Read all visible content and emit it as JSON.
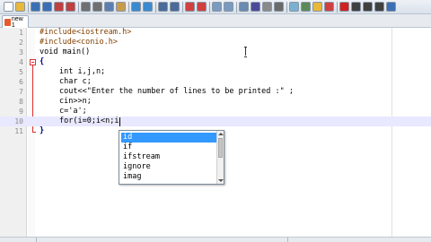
{
  "toolbar": {
    "buttons": [
      {
        "icon": "new-file-icon",
        "color": "#ffffff"
      },
      {
        "icon": "open-file-icon",
        "color": "#e8b83a"
      },
      {
        "icon": "save-icon",
        "color": "#3b6fb5"
      },
      {
        "icon": "save-all-icon",
        "color": "#3b6fb5"
      },
      {
        "icon": "close-icon",
        "color": "#c04040"
      },
      {
        "icon": "close-all-icon",
        "color": "#c04040"
      },
      {
        "icon": "print-icon",
        "color": "#707070"
      },
      {
        "icon": "cut-icon",
        "color": "#707070"
      },
      {
        "icon": "copy-icon",
        "color": "#5a7fb0"
      },
      {
        "icon": "paste-icon",
        "color": "#c89b4a"
      },
      {
        "icon": "undo-icon",
        "color": "#3a8ad0"
      },
      {
        "icon": "redo-icon",
        "color": "#3a8ad0"
      },
      {
        "icon": "find-icon",
        "color": "#4a6a9a"
      },
      {
        "icon": "replace-icon",
        "color": "#4a6a9a"
      },
      {
        "icon": "zoom-in-icon",
        "color": "#d04040"
      },
      {
        "icon": "zoom-out-icon",
        "color": "#d04040"
      },
      {
        "icon": "sync-v-icon",
        "color": "#7a9ac0"
      },
      {
        "icon": "sync-h-icon",
        "color": "#7a9ac0"
      },
      {
        "icon": "wrap-icon",
        "color": "#6a8ab0"
      },
      {
        "icon": "show-all-icon",
        "color": "#4a4a9a"
      },
      {
        "icon": "indent-guide-icon",
        "color": "#8a8a8a"
      },
      {
        "icon": "udl-icon",
        "color": "#6a6a6a"
      },
      {
        "icon": "doc-map-icon",
        "color": "#7ab0d0"
      },
      {
        "icon": "function-list-icon",
        "color": "#5a8a5a"
      },
      {
        "icon": "folder-workspace-icon",
        "color": "#e8b83a"
      },
      {
        "icon": "monitor-icon",
        "color": "#d04040"
      },
      {
        "icon": "record-macro-icon",
        "color": "#d02020"
      },
      {
        "icon": "stop-macro-icon",
        "color": "#404040"
      },
      {
        "icon": "play-macro-icon",
        "color": "#404040"
      },
      {
        "icon": "run-macro-multiple-icon",
        "color": "#404040"
      },
      {
        "icon": "save-macro-icon",
        "color": "#3b6fb5"
      }
    ]
  },
  "tabs": [
    {
      "label": "new 1",
      "icon": "file-modified-icon"
    }
  ],
  "editor": {
    "lines": [
      {
        "num": "1",
        "text": "#include<iostream.h>"
      },
      {
        "num": "2",
        "text": "#include<conio.h>"
      },
      {
        "num": "3",
        "text": "void main()"
      },
      {
        "num": "4",
        "text": "{"
      },
      {
        "num": "5",
        "text": "int i,j,n;"
      },
      {
        "num": "6",
        "text": "char c;"
      },
      {
        "num": "7",
        "text": "cout<<\"Enter the number of lines to be printed :\" ;"
      },
      {
        "num": "8",
        "text": "cin>>n;"
      },
      {
        "num": "9",
        "text": "c='a';"
      },
      {
        "num": "10",
        "text": "for(i=0;i<n;i"
      },
      {
        "num": "11",
        "text": "}"
      }
    ]
  },
  "autocomplete": {
    "items": [
      {
        "label": "id",
        "selected": true
      },
      {
        "label": "if",
        "selected": false
      },
      {
        "label": "ifstream",
        "selected": false
      },
      {
        "label": "ignore",
        "selected": false
      },
      {
        "label": "imag",
        "selected": false
      }
    ]
  },
  "colors": {
    "keyword": "#0000ff",
    "preprocessor": "#804000",
    "type": "#8000ff",
    "string": "#808080",
    "number": "#ff8000",
    "selection": "#3399ff"
  }
}
